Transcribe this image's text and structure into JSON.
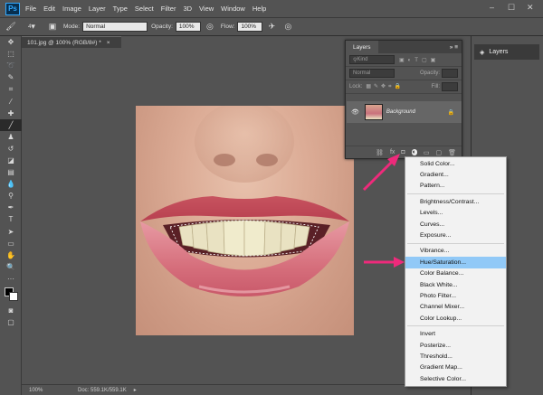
{
  "menubar": {
    "logo": "Ps",
    "items": [
      "File",
      "Edit",
      "Image",
      "Layer",
      "Type",
      "Select",
      "Filter",
      "3D",
      "View",
      "Window",
      "Help"
    ],
    "win_controls": [
      "–",
      "☐",
      "✕"
    ]
  },
  "options": {
    "mode_label": "Mode:",
    "mode_value": "Normal",
    "opacity_label": "Opacity:",
    "opacity_value": "100%",
    "flow_label": "Flow:",
    "flow_value": "100%",
    "brush_size": "4"
  },
  "document": {
    "tab_title": "101.jpg @ 100% (RGB/8#) *",
    "tab_close": "×",
    "zoom": "100%",
    "doc_info": "Doc: 559.1K/559.1K"
  },
  "right_panel": {
    "layers_label": "Layers"
  },
  "layers_panel": {
    "tab": "Layers",
    "header_icons": "» ≡",
    "kind_placeholder": "Kind",
    "blend": "Normal",
    "opacity_label": "Opacity:",
    "lock_label": "Lock:",
    "fill_label": "Fill:",
    "layer_name": "Background",
    "foot_icons": [
      "⛓",
      "fx",
      "◘",
      "◐",
      "▭",
      "▢",
      "🗑"
    ]
  },
  "dropdown": {
    "groups": [
      [
        "Solid Color...",
        "Gradient...",
        "Pattern..."
      ],
      [
        "Brightness/Contrast...",
        "Levels...",
        "Curves...",
        "Exposure..."
      ],
      [
        "Vibrance...",
        "Hue/Saturation...",
        "Color Balance...",
        "Black  White...",
        "Photo Filter...",
        "Channel Mixer...",
        "Color Lookup..."
      ],
      [
        "Invert",
        "Posterize...",
        "Threshold...",
        "Gradient Map...",
        "Selective Color..."
      ]
    ],
    "highlighted": "Hue/Saturation..."
  },
  "colors": {
    "arrow": "#ee2a7b",
    "highlight": "#91c9f7"
  }
}
